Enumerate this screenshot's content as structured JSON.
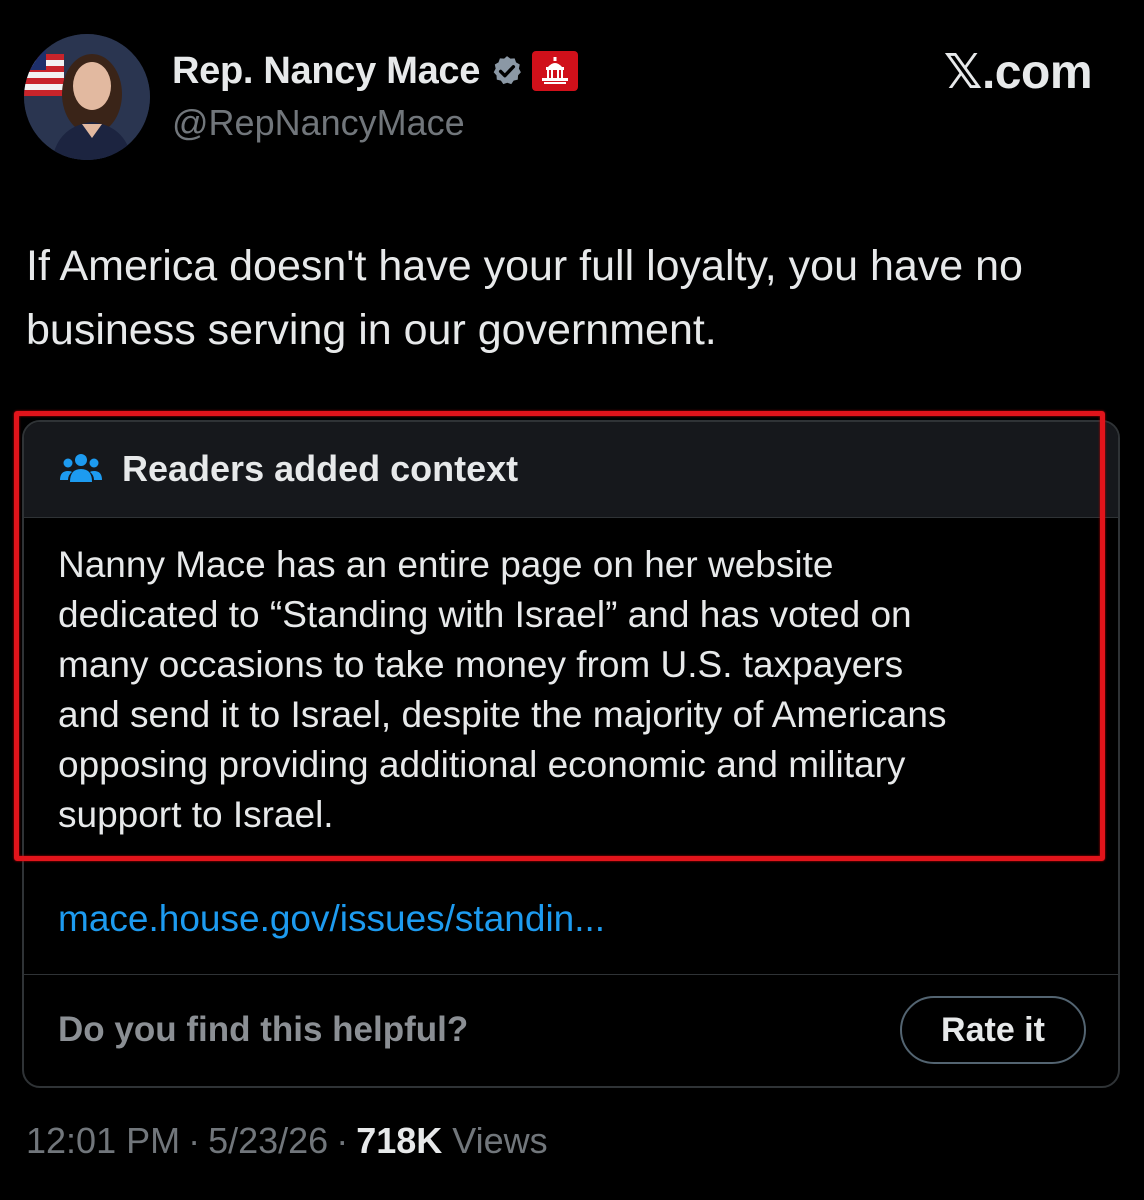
{
  "profile": {
    "display_name": "Rep. Nancy Mace",
    "handle": "@RepNancyMace",
    "avatar_icon": "profile-photo",
    "verified_icon": "verified-badge-icon",
    "affiliation_icon": "house-gop-badge-icon"
  },
  "brand": {
    "x_mark": "𝕏",
    "suffix": ".com"
  },
  "tweet": {
    "text": "If America doesn't have your full loyalty, you have no business serving in our government."
  },
  "community_note": {
    "header_icon": "people-icon",
    "title": "Readers added context",
    "body": "Nanny Mace has an entire page on her website\ndedicated to “Standing with Israel” and has voted on\nmany occasions to take money from U.S. taxpayers\nand send it to Israel, despite the majority of Americans\nopposing providing additional economic and military\nsupport to Israel.",
    "link": "mace.house.gov/issues/standin...",
    "helpful_question": "Do you find this helpful?",
    "rate_label": "Rate it"
  },
  "meta": {
    "time": "12:01 PM",
    "separator": "·",
    "date": "5/23/26",
    "views_count": "718K",
    "views_label": "Views"
  },
  "colors": {
    "background": "#000000",
    "text": "#e7e9ea",
    "muted": "#71767b",
    "link": "#1d9bf0",
    "verified": "#8b98a5",
    "highlight": "#e1141b"
  }
}
